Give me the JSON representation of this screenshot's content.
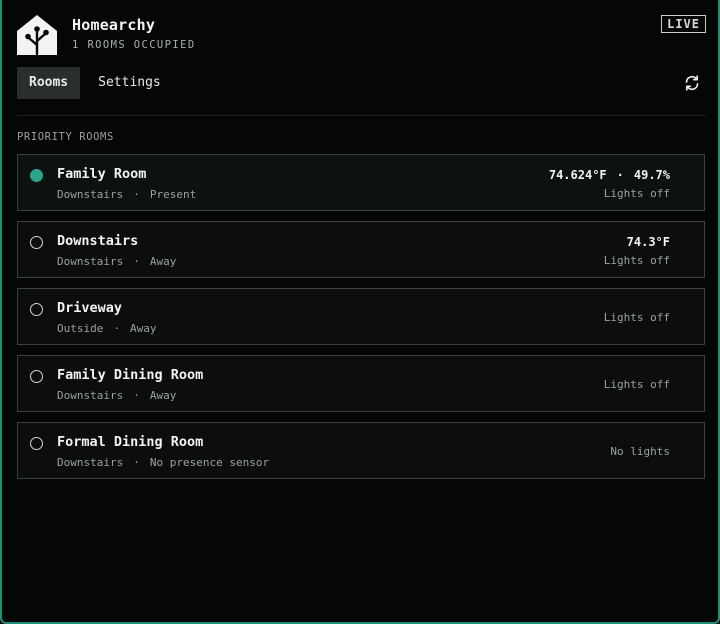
{
  "app": {
    "title": "Homearchy",
    "occupancy": "1 ROOMS OCCUPIED",
    "live_badge": "LIVE",
    "logo_icon": "home-assistant-icon"
  },
  "tabs": [
    {
      "label": "Rooms",
      "active": true
    },
    {
      "label": "Settings",
      "active": false
    }
  ],
  "toolbar": {
    "refresh_icon": "refresh-icon"
  },
  "section": {
    "label": "PRIORITY ROOMS"
  },
  "rooms": [
    {
      "name": "Family Room",
      "area": "Downstairs",
      "presence": "Present",
      "temperature": "74.624°F",
      "humidity": "49.7%",
      "lights": "Lights off",
      "occupied": true
    },
    {
      "name": "Downstairs",
      "area": "Downstairs",
      "presence": "Away",
      "temperature": "74.3°F",
      "humidity": "",
      "lights": "Lights off",
      "occupied": false
    },
    {
      "name": "Driveway",
      "area": "Outside",
      "presence": "Away",
      "temperature": "",
      "humidity": "",
      "lights": "Lights off",
      "occupied": false
    },
    {
      "name": "Family Dining Room",
      "area": "Downstairs",
      "presence": "Away",
      "temperature": "",
      "humidity": "",
      "lights": "Lights off",
      "occupied": false
    },
    {
      "name": "Formal Dining Room",
      "area": "Downstairs",
      "presence": "No presence sensor",
      "temperature": "",
      "humidity": "",
      "lights": "No lights",
      "occupied": false
    }
  ],
  "separator": "·",
  "colors": {
    "accent": "#2aa58a",
    "background": "#050606",
    "card_border": "#3a4240"
  }
}
